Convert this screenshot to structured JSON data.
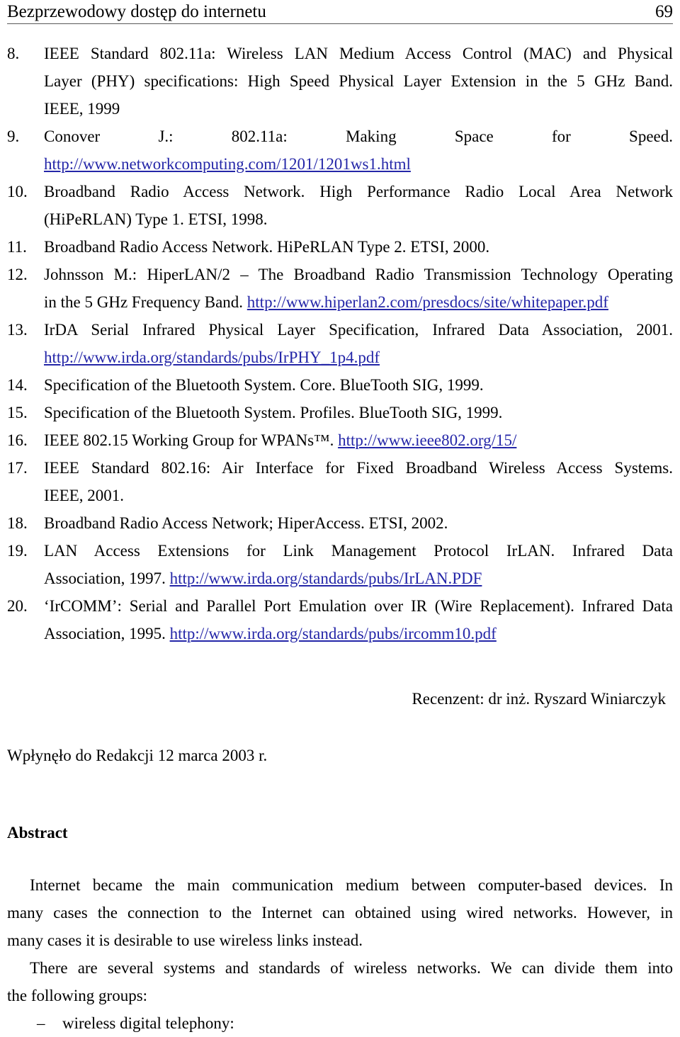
{
  "header": {
    "title": "Bezprzewodowy dostęp do internetu",
    "page_number": "69"
  },
  "references": [
    {
      "number": "8.",
      "lines": [
        "IEEE Standard 802.11a: Wireless LAN Medium Access Control (MAC) and Physical",
        "Layer (PHY) specifications: High Speed Physical Layer Extension in the 5 GHz Band.",
        "IEEE, 1999"
      ]
    },
    {
      "number": "9.",
      "lines": [
        "Conover J.: 802.11a: Making Space for Speed."
      ],
      "link_line": "http://www.networkcomputing.com/1201/1201ws1.html"
    },
    {
      "number": "10.",
      "lines": [
        "Broadband Radio Access Network. High Performance Radio Local Area Network",
        "(HiPeRLAN) Type 1. ETSI, 1998."
      ]
    },
    {
      "number": "11.",
      "lines": [
        "Broadband Radio Access Network. HiPeRLAN Type 2. ETSI, 2000."
      ]
    },
    {
      "number": "12.",
      "lines": [
        "Johnsson M.: HiperLAN/2 – The Broadband Radio Transmission Technology Operating"
      ],
      "tail_text": "in the 5 GHz Frequency Band. ",
      "tail_link": "http://www.hiperlan2.com/presdocs/site/whitepaper.pdf"
    },
    {
      "number": "13.",
      "lines": [
        "IrDA Serial Infrared Physical Layer Specification, Infrared Data Association, 2001."
      ],
      "link_line": "http://www.irda.org/standards/pubs/IrPHY_1p4.pdf"
    },
    {
      "number": "14.",
      "lines": [
        "Specification of the Bluetooth System. Core. BlueTooth SIG, 1999."
      ]
    },
    {
      "number": "15.",
      "lines": [
        "Specification of the Bluetooth System. Profiles. BlueTooth SIG, 1999."
      ]
    },
    {
      "number": "16.",
      "tail_text": "IEEE 802.15 Working Group for WPANs™. ",
      "tail_link": "http://www.ieee802.org/15/"
    },
    {
      "number": "17.",
      "lines": [
        "IEEE Standard 802.16: Air Interface for Fixed Broadband Wireless Access Systems.",
        "IEEE, 2001."
      ]
    },
    {
      "number": "18.",
      "lines": [
        "Broadband Radio Access Network; HiperAccess. ETSI, 2002."
      ]
    },
    {
      "number": "19.",
      "lines": [
        "LAN Access Extensions for Link Management Protocol IrLAN. Infrared Data"
      ],
      "tail_text": "Association, 1997. ",
      "tail_link": "http://www.irda.org/standards/pubs/IrLAN.PDF"
    },
    {
      "number": "20.",
      "lines": [
        "‘IrCOMM’: Serial and Parallel Port Emulation over IR (Wire Replacement). Infrared Data"
      ],
      "tail_text": "Association, 1995. ",
      "tail_link": "http://www.irda.org/standards/pubs/ircomm10.pdf"
    }
  ],
  "reviewer": "Recenzent: dr inż. Ryszard Winiarczyk",
  "received": "Wpłynęło do Redakcji 12 marca 2003 r.",
  "abstract": {
    "heading": "Abstract",
    "paragraph1": [
      "Internet became the main communication medium between computer-based devices. In",
      "many cases the connection to the Internet can obtained using wired networks. However, in",
      "many cases it is desirable to use wireless links instead."
    ],
    "paragraph2": [
      "There are several systems and standards of wireless networks. We can divide them into",
      "the following groups:"
    ],
    "bullet_dash": "–",
    "bullet1": "wireless digital telephony:"
  },
  "colors": {
    "link": "#2426a8",
    "text": "#000000",
    "rule": "#5a5a5a"
  }
}
